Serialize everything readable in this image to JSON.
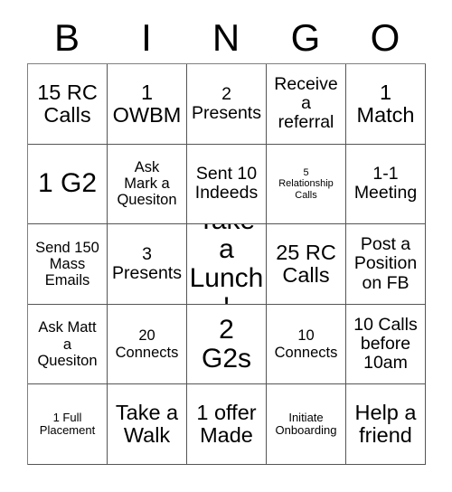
{
  "header": {
    "letters": [
      "B",
      "I",
      "N",
      "G",
      "O"
    ]
  },
  "grid": {
    "rows": 5,
    "columns": 5,
    "border_color": "#555555",
    "background_color": "#ffffff",
    "text_color": "#000000",
    "cells": [
      {
        "text": "15 RC\nCalls",
        "size": "xl"
      },
      {
        "text": "1\nOWBM",
        "size": "xl"
      },
      {
        "text": "2\nPresents",
        "size": "l"
      },
      {
        "text": "Receive\na\nreferral",
        "size": "l"
      },
      {
        "text": "1\nMatch",
        "size": "xl"
      },
      {
        "text": "1 G2",
        "size": "xxl"
      },
      {
        "text": "Ask\nMark a\nQuesiton",
        "size": "m"
      },
      {
        "text": "Sent 10\nIndeeds",
        "size": "l"
      },
      {
        "text": "5\nRelationship\nCalls",
        "size": "xs"
      },
      {
        "text": "1-1\nMeeting",
        "size": "l"
      },
      {
        "text": "Send 150\nMass\nEmails",
        "size": "m"
      },
      {
        "text": "3\nPresents",
        "size": "l"
      },
      {
        "text": "Take a\nLunch!",
        "size": "xxl"
      },
      {
        "text": "25 RC\nCalls",
        "size": "xl"
      },
      {
        "text": "Post a\nPosition\non FB",
        "size": "l"
      },
      {
        "text": "Ask Matt\na\nQuesiton",
        "size": "m"
      },
      {
        "text": "20\nConnects",
        "size": "m"
      },
      {
        "text": "2\nG2s",
        "size": "xxl"
      },
      {
        "text": "10\nConnects",
        "size": "m"
      },
      {
        "text": "10 Calls\nbefore\n10am",
        "size": "l"
      },
      {
        "text": "1 Full\nPlacement",
        "size": "s"
      },
      {
        "text": "Take a\nWalk",
        "size": "xl"
      },
      {
        "text": "1 offer\nMade",
        "size": "xl"
      },
      {
        "text": "Initiate\nOnboarding",
        "size": "s"
      },
      {
        "text": "Help a\nfriend",
        "size": "xl"
      }
    ]
  }
}
